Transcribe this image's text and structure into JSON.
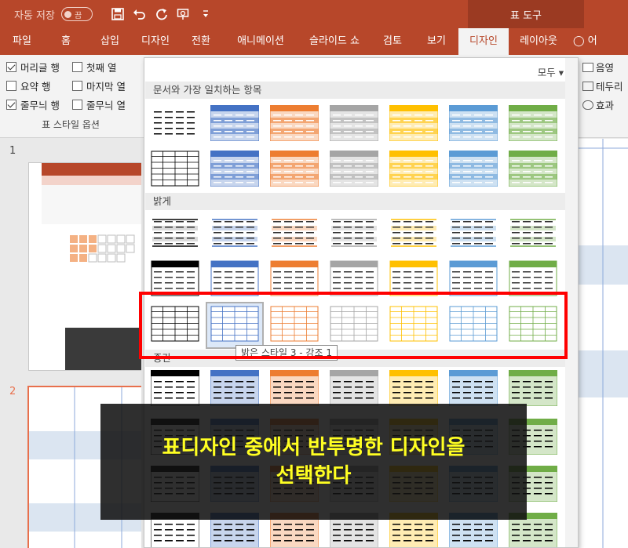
{
  "titlebar": {
    "autosave_label": "자동 저장",
    "autosave_state": "끔",
    "context_tools_label": "표 도구",
    "accent_color": "#b7472a"
  },
  "tabs": [
    {
      "label": "파일",
      "active": false
    },
    {
      "label": "홈",
      "active": false
    },
    {
      "label": "삽입",
      "active": false
    },
    {
      "label": "디자인",
      "active": false
    },
    {
      "label": "전환",
      "active": false
    },
    {
      "label": "애니메이션",
      "active": false
    },
    {
      "label": "슬라이드 쇼",
      "active": false
    },
    {
      "label": "검토",
      "active": false
    },
    {
      "label": "보기",
      "active": false
    },
    {
      "label": "디자인",
      "active": true
    },
    {
      "label": "레이아웃",
      "active": false
    },
    {
      "label": "어떤",
      "active": false
    }
  ],
  "style_options": {
    "group_label": "표 스타일 옵션",
    "items": [
      {
        "label": "머리글 행",
        "checked": true
      },
      {
        "label": "첫째 열",
        "checked": false
      },
      {
        "label": "요약 행",
        "checked": false
      },
      {
        "label": "마지막 열",
        "checked": false
      },
      {
        "label": "줄무늬 행",
        "checked": true
      },
      {
        "label": "줄무늬 열",
        "checked": false
      }
    ]
  },
  "ribbon_right": {
    "shading": "음영",
    "borders": "테두리",
    "effects": "효과"
  },
  "slides": {
    "numbers": [
      "1",
      "2"
    ]
  },
  "gallery": {
    "filter": "모두",
    "sections": {
      "best_match": "문서와 가장 일치하는 항목",
      "light": "밝게",
      "medium": "중간"
    },
    "tooltip": "밝은 스타일 3 - 강조 1",
    "accent_colors": [
      "#000000",
      "#4472c4",
      "#ed7d31",
      "#a5a5a5",
      "#ffc000",
      "#5b9bd5",
      "#70ad47"
    ]
  },
  "caption": {
    "line1": "표디자인 중에서 반투명한 디자인을",
    "line2": "선택한다"
  }
}
